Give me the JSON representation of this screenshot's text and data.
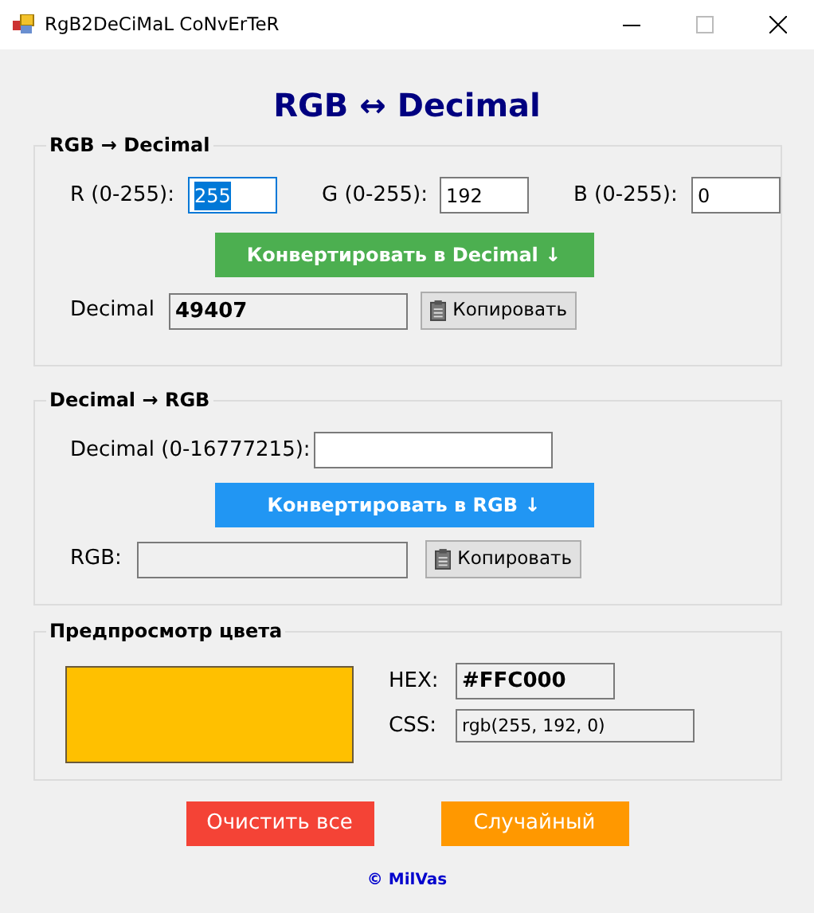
{
  "window": {
    "title": "RgB2DeCiMaL CoNvErTeR"
  },
  "heading": "RGB ↔ Decimal",
  "rgb_to_decimal": {
    "title": "RGB → Decimal",
    "inputs": [
      {
        "label": "R (0-255):",
        "value": "255",
        "text_selected": true
      },
      {
        "label": "G (0-255):",
        "value": "192",
        "text_selected": false
      },
      {
        "label": "B (0-255):",
        "value": "0",
        "text_selected": false
      }
    ],
    "convert_button": "Конвертировать в Decimal ↓",
    "result_label": "Decimal",
    "result_value": "49407",
    "copy_button": "Копировать"
  },
  "decimal_to_rgb": {
    "title": "Decimal → RGB",
    "input_label": "Decimal (0-16777215):",
    "convert_button": "Конвертировать в RGB ↓",
    "result_label": "RGB:",
    "copy_button": "Копировать"
  },
  "preview": {
    "title": "Предпросмотр цвета",
    "color": "#ffc000",
    "hex_label": "HEX:",
    "hex_value": "#FFC000",
    "css_label": "CSS:",
    "css_value": "rgb(255, 192, 0)"
  },
  "buttons": [
    {
      "label": "Очистить все",
      "color": "#f44336"
    },
    {
      "label": "Случайный",
      "color": "#ff9800"
    }
  ],
  "footer": "© MilVas"
}
